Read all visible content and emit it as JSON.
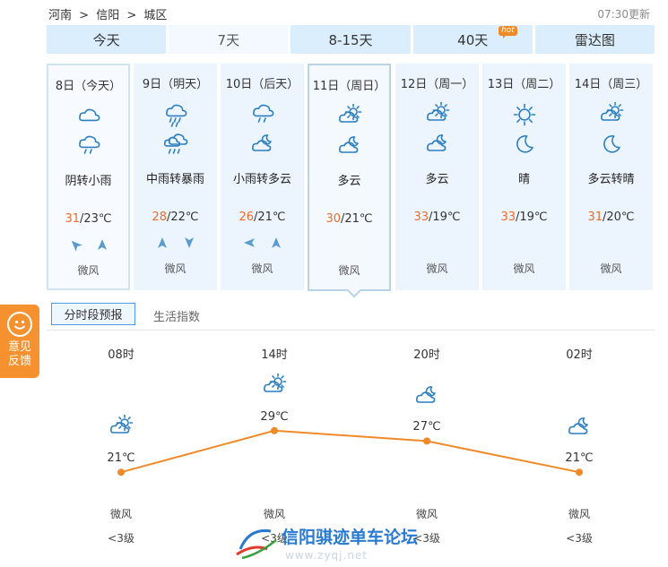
{
  "breadcrumb": [
    "河南",
    ">",
    "信阳",
    ">",
    "城区"
  ],
  "update_time": "07:30更新",
  "tabs": [
    {
      "label": "今天"
    },
    {
      "label": "7天"
    },
    {
      "label": "8-15天"
    },
    {
      "label": "40天",
      "badge": "hot"
    },
    {
      "label": "雷达图"
    }
  ],
  "days": [
    {
      "date": "8日（今天）",
      "icon_day": "cloudy-icon",
      "icon_night": "light-rain-icon",
      "desc": "阴转小雨",
      "hi": "31",
      "lo": "/23℃",
      "wind_dirs": [
        "northwest-arrow",
        "north-arrow"
      ],
      "wind": "微风"
    },
    {
      "date": "9日（明天）",
      "icon_day": "moderate-rain-icon",
      "icon_night": "rainstorm-icon",
      "desc": "中雨转暴雨",
      "hi": "28",
      "lo": "/22℃",
      "wind_dirs": [
        "north-arrow",
        "south-arrow"
      ],
      "wind": "微风"
    },
    {
      "date": "10日（后天）",
      "icon_day": "light-rain-icon",
      "icon_night": "partly-cloudy-night-icon",
      "desc": "小雨转多云",
      "hi": "26",
      "lo": "/21℃",
      "wind_dirs": [
        "west-arrow",
        "north-arrow"
      ],
      "wind": "微风"
    },
    {
      "date": "11日（周日）",
      "icon_day": "partly-cloudy-day-icon",
      "icon_night": "partly-cloudy-night-icon",
      "desc": "多云",
      "hi": "30",
      "lo": "/21℃",
      "wind_dirs": [],
      "wind": "微风"
    },
    {
      "date": "12日（周一）",
      "icon_day": "partly-cloudy-day-icon",
      "icon_night": "partly-cloudy-night-icon",
      "desc": "多云",
      "hi": "33",
      "lo": "/19℃",
      "wind_dirs": [],
      "wind": "微风"
    },
    {
      "date": "13日（周二）",
      "icon_day": "sunny-icon",
      "icon_night": "moon-icon",
      "desc": "晴",
      "hi": "33",
      "lo": "/19℃",
      "wind_dirs": [],
      "wind": "微风"
    },
    {
      "date": "14日（周三）",
      "icon_day": "partly-cloudy-day-icon",
      "icon_night": "moon-icon",
      "desc": "多云转晴",
      "hi": "31",
      "lo": "/20℃",
      "wind_dirs": [],
      "wind": "微风"
    }
  ],
  "feedback": {
    "line1": "意见",
    "line2": "反馈"
  },
  "subtabs": {
    "hourly": "分时段预报",
    "life": "生活指数"
  },
  "hourly": [
    {
      "time": "08时",
      "icon": "partly-cloudy-day-icon",
      "temp": 21,
      "temp_label": "21℃",
      "wind": "微风",
      "level": "<3级"
    },
    {
      "time": "14时",
      "icon": "partly-cloudy-day-icon",
      "temp": 29,
      "temp_label": "29℃",
      "wind": "微风",
      "level": "<3级"
    },
    {
      "time": "20时",
      "icon": "partly-cloudy-night-icon",
      "temp": 27,
      "temp_label": "27℃",
      "wind": "微风",
      "level": "<3级"
    },
    {
      "time": "02时",
      "icon": "partly-cloudy-night-icon",
      "temp": 21,
      "temp_label": "21℃",
      "wind": "微风",
      "level": "<3级"
    }
  ],
  "colors": {
    "accent": "#f08a28",
    "line": "#f08a28",
    "hi_temp": "#f06b28",
    "tab_bg": "#daeefd",
    "icon": "#2d7fc0"
  },
  "watermark": {
    "text": "信阳骐迹单车论坛",
    "url": "www.zyqj.net"
  }
}
